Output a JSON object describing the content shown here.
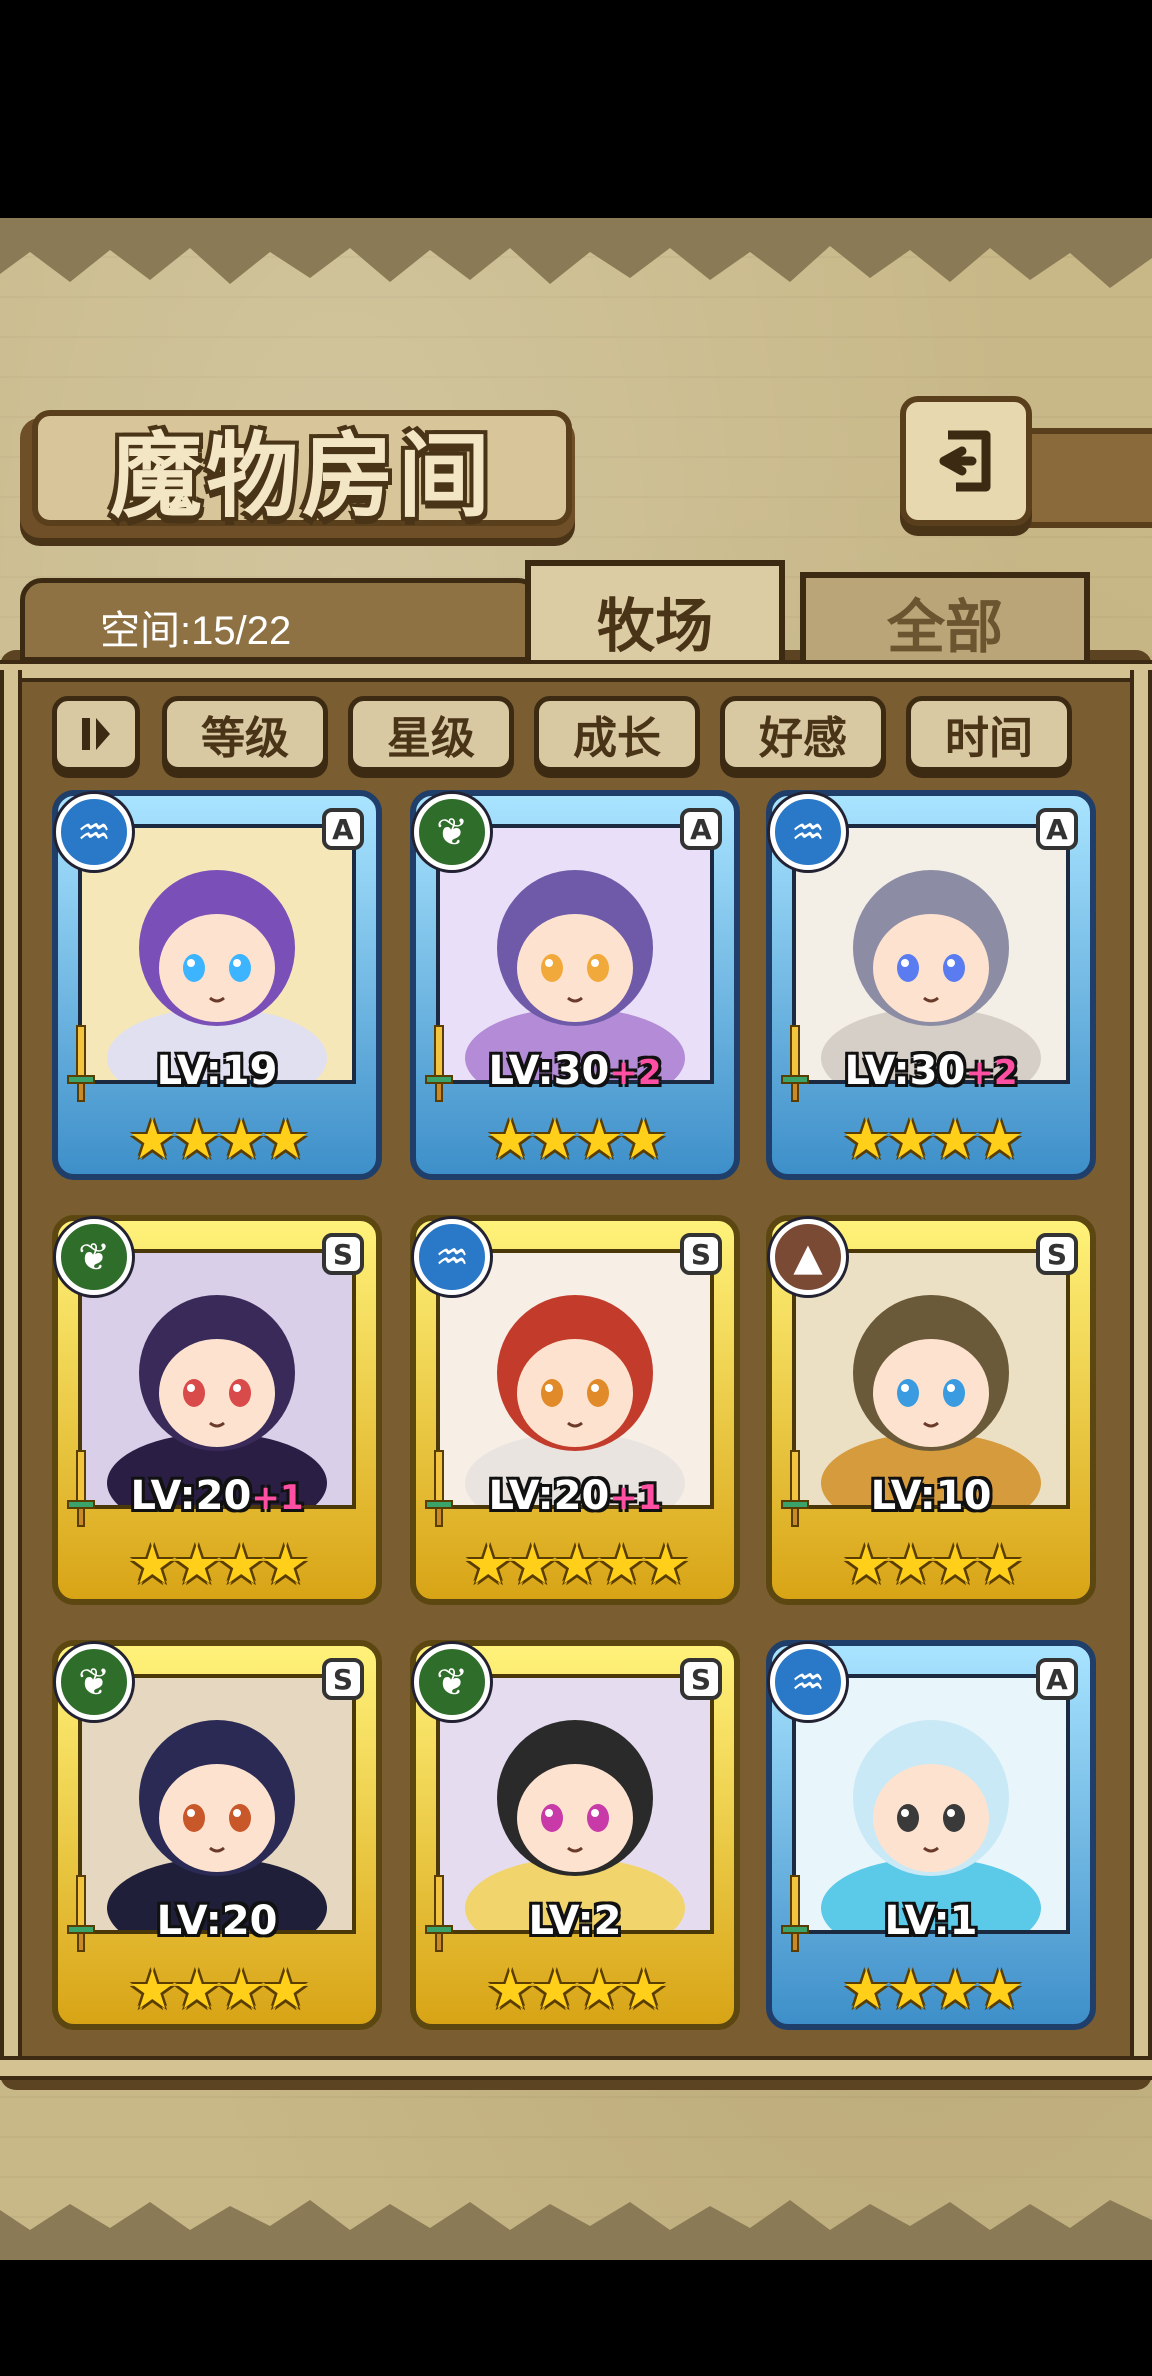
{
  "title": "魔物房间",
  "space_label": "空间:15/22",
  "tabs": [
    {
      "label": "牧场",
      "active": true
    },
    {
      "label": "全部",
      "active": false
    }
  ],
  "sort_buttons": [
    "等级",
    "星级",
    "成长",
    "好感",
    "时间"
  ],
  "sort_toggle_icon": "sort-order-icon",
  "back_icon": "return-arrow-icon",
  "monsters": [
    {
      "rank": "A",
      "element": "water",
      "level": "LV:19",
      "bonus": "",
      "stars": 4
    },
    {
      "rank": "A",
      "element": "leaf",
      "level": "LV:30",
      "bonus": "+2",
      "stars": 4
    },
    {
      "rank": "A",
      "element": "water",
      "level": "LV:30",
      "bonus": "+2",
      "stars": 4
    },
    {
      "rank": "S",
      "element": "leaf",
      "level": "LV:20",
      "bonus": "+1",
      "stars": 4
    },
    {
      "rank": "S",
      "element": "water",
      "level": "LV:20",
      "bonus": "+1",
      "stars": 5
    },
    {
      "rank": "S",
      "element": "earth",
      "level": "LV:10",
      "bonus": "",
      "stars": 4
    },
    {
      "rank": "S",
      "element": "leaf",
      "level": "LV:20",
      "bonus": "",
      "stars": 4
    },
    {
      "rank": "S",
      "element": "leaf",
      "level": "LV:2",
      "bonus": "",
      "stars": 4
    },
    {
      "rank": "A",
      "element": "water",
      "level": "LV:1",
      "bonus": "",
      "stars": 4
    }
  ],
  "colors": {
    "rank_A_frame": "#3e8fc9",
    "rank_S_frame": "#d8a416",
    "element_water": "#2a78c8",
    "element_leaf": "#2f6d2a",
    "element_earth": "#7a4a35",
    "bonus_text": "#ff4fa3"
  }
}
